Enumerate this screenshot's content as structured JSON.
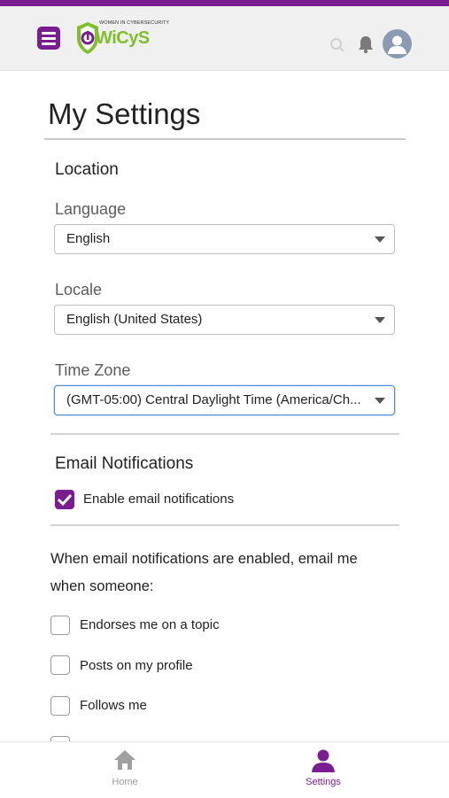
{
  "header": {
    "logo": {
      "tagline": "WOMEN IN CYBERSECURITY",
      "wordmark": "WiCyS",
      "brand_colors": [
        "#7fbf2a",
        "#7a1e8f"
      ]
    },
    "icons": [
      "hamburger-menu-icon",
      "search-icon",
      "bell-icon",
      "user-avatar-icon"
    ]
  },
  "page": {
    "title": "My Settings",
    "location": {
      "heading": "Location",
      "language": {
        "label": "Language",
        "value": "English"
      },
      "locale": {
        "label": "Locale",
        "value": "English (United States)"
      },
      "timezone": {
        "label": "Time Zone",
        "value": "(GMT-05:00) Central Daylight Time (America/Ch..."
      }
    },
    "email": {
      "heading": "Email Notifications",
      "enable_label": "Enable email notifications",
      "enable_checked": true,
      "intro": "When email notifications are enabled, email me when someone:",
      "options": [
        {
          "label": "Endorses me on a topic",
          "checked": false
        },
        {
          "label": "Posts on my profile",
          "checked": false
        },
        {
          "label": "Follows me",
          "checked": false
        }
      ]
    }
  },
  "nav": {
    "home_label": "Home",
    "settings_label": "Settings",
    "active": "Settings"
  },
  "colors": {
    "accent": "#7a1e8f",
    "focus": "#4a8fd6",
    "inactive_nav": "#9e9e9e"
  }
}
